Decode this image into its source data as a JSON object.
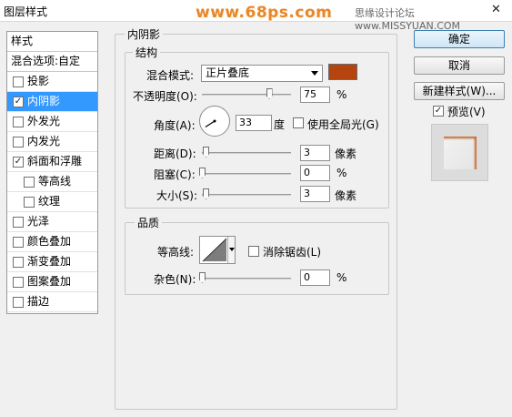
{
  "window": {
    "title": "图层样式",
    "close_glyph": "✕",
    "watermark": "www.68ps.com",
    "forum": "思缘设计论坛  www.MISSYUAN.COM"
  },
  "sidebar": {
    "header": "样式",
    "blend_options": "混合选项:自定",
    "items": [
      {
        "label": "投影",
        "checked": false,
        "selected": false,
        "sub": false
      },
      {
        "label": "内阴影",
        "checked": true,
        "selected": true,
        "sub": false
      },
      {
        "label": "外发光",
        "checked": false,
        "selected": false,
        "sub": false
      },
      {
        "label": "内发光",
        "checked": false,
        "selected": false,
        "sub": false
      },
      {
        "label": "斜面和浮雕",
        "checked": true,
        "selected": false,
        "sub": false
      },
      {
        "label": "等高线",
        "checked": false,
        "selected": false,
        "sub": true
      },
      {
        "label": "纹理",
        "checked": false,
        "selected": false,
        "sub": true
      },
      {
        "label": "光泽",
        "checked": false,
        "selected": false,
        "sub": false
      },
      {
        "label": "颜色叠加",
        "checked": false,
        "selected": false,
        "sub": false
      },
      {
        "label": "渐变叠加",
        "checked": false,
        "selected": false,
        "sub": false
      },
      {
        "label": "图案叠加",
        "checked": false,
        "selected": false,
        "sub": false
      },
      {
        "label": "描边",
        "checked": false,
        "selected": false,
        "sub": false
      }
    ]
  },
  "panel": {
    "section_title": "内阴影",
    "structure": {
      "title": "结构",
      "blend_mode_label": "混合模式:",
      "blend_mode_value": "正片叠底",
      "shadow_color": "#b5440e",
      "opacity_label": "不透明度(O):",
      "opacity_value": "75",
      "opacity_level": 0.75,
      "opacity_unit": "%",
      "angle_label": "角度(A):",
      "angle_value": "33",
      "angle_unit": "度",
      "global_light_label": "使用全局光(G)",
      "global_light_checked": false,
      "distance_label": "距离(D):",
      "distance_value": "3",
      "distance_unit": "像素",
      "choke_label": "阻塞(C):",
      "choke_value": "0",
      "choke_unit": "%",
      "size_label": "大小(S):",
      "size_value": "3",
      "size_unit": "像素"
    },
    "quality": {
      "title": "品质",
      "contour_label": "等高线:",
      "anti_alias_label": "消除锯齿(L)",
      "anti_alias_checked": false,
      "noise_label": "杂色(N):",
      "noise_value": "0",
      "noise_unit": "%"
    }
  },
  "buttons": {
    "ok": "确定",
    "cancel": "取消",
    "new_style": "新建样式(W)...",
    "preview_label": "预览(V)",
    "preview_checked": true
  }
}
